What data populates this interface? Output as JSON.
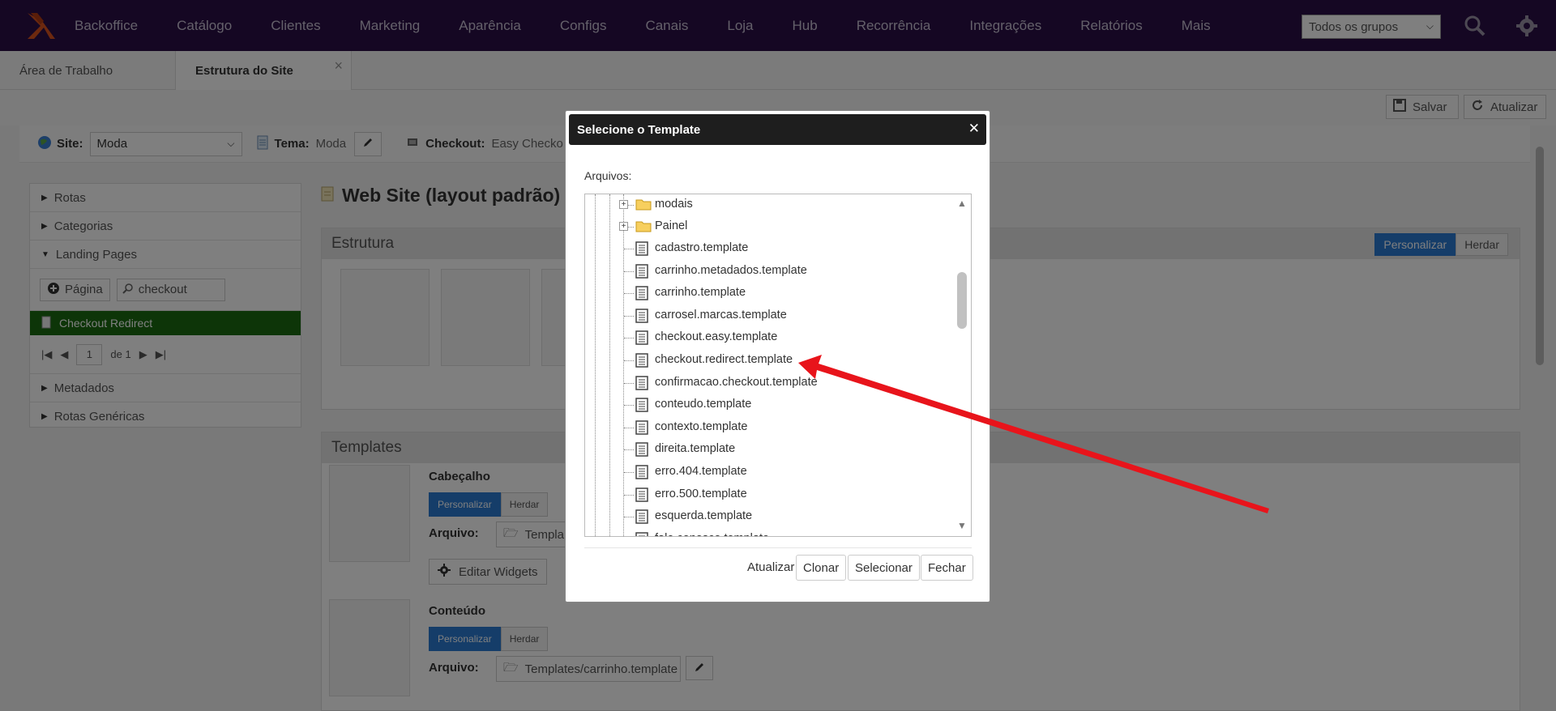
{
  "topnav": {
    "brand": "Backoffice",
    "items": [
      "Catálogo",
      "Clientes",
      "Marketing",
      "Aparência",
      "Configs",
      "Canais",
      "Loja",
      "Hub",
      "Recorrência",
      "Integrações",
      "Relatórios",
      "Mais"
    ],
    "group_select": "Todos os grupos",
    "bg_color": "#2b0e47"
  },
  "tabs": [
    {
      "label": "Área de Trabalho"
    },
    {
      "label": "Estrutura do Site"
    }
  ],
  "toolbar": {
    "save_label": "Salvar",
    "refresh_label": "Atualizar"
  },
  "sitebar": {
    "site_label": "Site:",
    "site_value": "Moda",
    "tema_label": "Tema:",
    "tema_value": "Moda",
    "checkout_label": "Checkout:",
    "checkout_value": "Easy Checko"
  },
  "leftpanel": {
    "rotas": "Rotas",
    "categorias": "Categorias",
    "landing_pages": "Landing Pages",
    "pagina_btn": "Página",
    "search_value": "checkout",
    "selected_item": "Checkout Redirect",
    "pager_page": "1",
    "pager_of": "de 1",
    "metadados": "Metadados",
    "rotas_genericas": "Rotas Genéricas",
    "selected_color": "#1a6b10"
  },
  "main": {
    "title": "Web Site (layout padrão)",
    "estrutura_label": "Estrutura",
    "personalizar": "Personalizar",
    "herdar": "Herdar",
    "templates_label": "Templates",
    "cabecalho": "Cabeçalho",
    "conteudo": "Conteúdo",
    "arquivo_label": "Arquivo:",
    "cabecalho_file": "Templa",
    "conteudo_file": "Templates/carrinho.template",
    "editar_widgets": "Editar Widgets",
    "accent_color": "#2a7bd3"
  },
  "modal": {
    "title": "Selecione o Template",
    "arquivos_label": "Arquivos:",
    "folders": [
      "modais",
      "Painel"
    ],
    "files": [
      "cadastro.template",
      "carrinho.metadados.template",
      "carrinho.template",
      "carrosel.marcas.template",
      "checkout.easy.template",
      "checkout.redirect.template",
      "confirmacao.checkout.template",
      "conteudo.template",
      "contexto.template",
      "direita.template",
      "erro.404.template",
      "erro.500.template",
      "esquerda.template",
      "fale.conosco.template"
    ],
    "atualizar": "Atualizar",
    "clonar": "Clonar",
    "selecionar": "Selecionar",
    "fechar": "Fechar",
    "arrow_color": "#e8141b"
  }
}
